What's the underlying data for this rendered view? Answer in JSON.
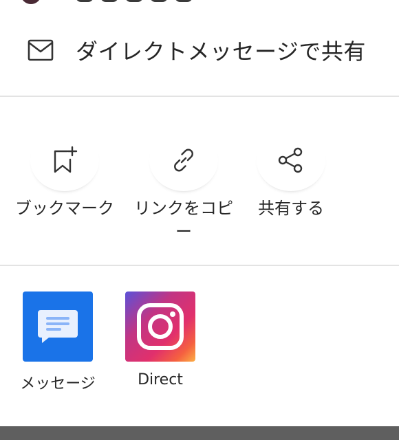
{
  "share_sheet": {
    "direct_message": {
      "icon": "mail-icon",
      "label": "ダイレクトメッセージで共有"
    },
    "actions": [
      {
        "icon": "bookmark-add-icon",
        "label": "ブックマーク"
      },
      {
        "icon": "link-icon",
        "label": "リンクをコピー"
      },
      {
        "icon": "share-icon",
        "label": "共有する"
      }
    ],
    "apps": [
      {
        "icon": "messages-app-icon",
        "label": "メッセージ",
        "color": "#1a73e8"
      },
      {
        "icon": "instagram-app-icon",
        "label": "Direct"
      }
    ]
  }
}
